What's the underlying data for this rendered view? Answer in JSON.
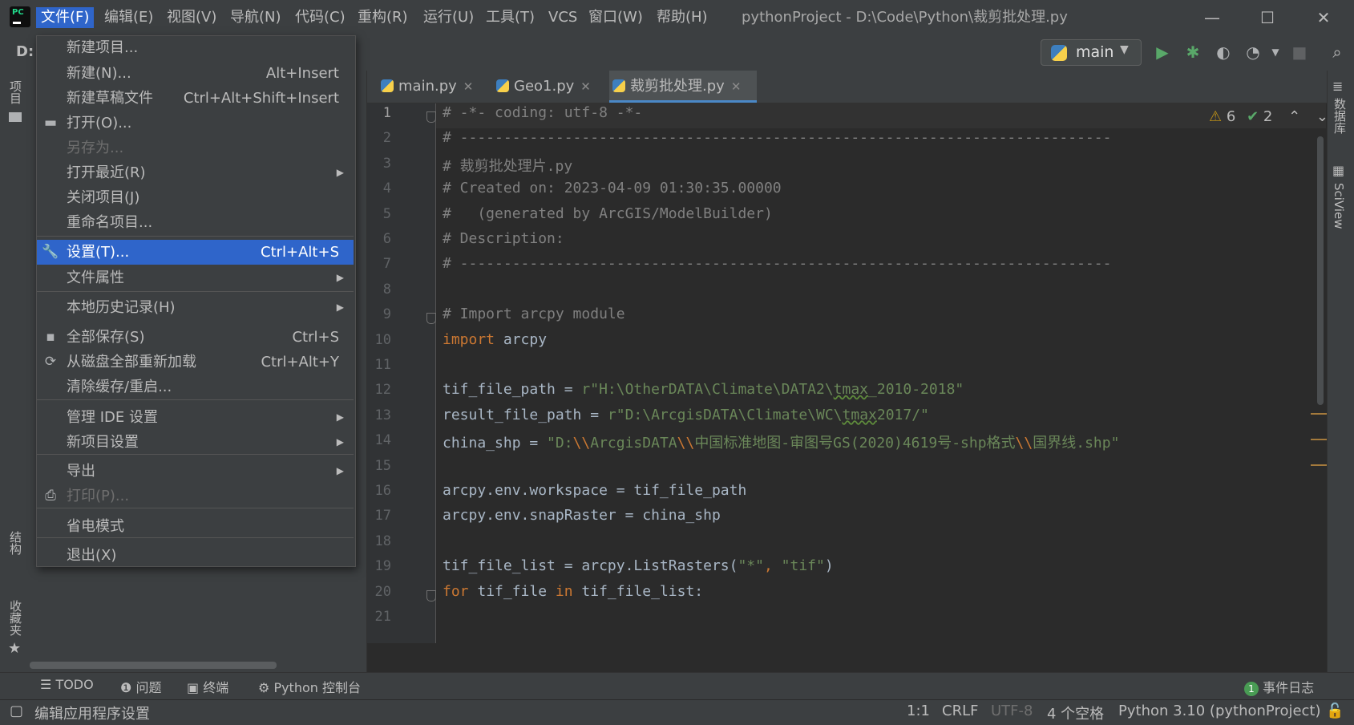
{
  "menubar": {
    "items": [
      "文件(F)",
      "编辑(E)",
      "视图(V)",
      "导航(N)",
      "代码(C)",
      "重构(R)",
      "运行(U)",
      "工具(T)",
      "VCS",
      "窗口(W)",
      "帮助(H)"
    ],
    "active_index": 0
  },
  "window": {
    "title": "pythonProject - D:\\Code\\Python\\裁剪批处理.py",
    "minimize": "—",
    "maximize": "☐",
    "close": "✕"
  },
  "toolbar": {
    "breadcrumb": "D:",
    "run_config": "main"
  },
  "file_menu": {
    "items": [
      {
        "label": "新建项目...",
        "shortcut": "",
        "submenu": false,
        "disabled": false,
        "icon": ""
      },
      {
        "label": "新建(N)...",
        "shortcut": "Alt+Insert",
        "submenu": false,
        "disabled": false,
        "icon": ""
      },
      {
        "label": "新建草稿文件",
        "shortcut": "Ctrl+Alt+Shift+Insert",
        "submenu": false,
        "disabled": false,
        "icon": ""
      },
      {
        "label": "打开(O)...",
        "shortcut": "",
        "submenu": false,
        "disabled": false,
        "icon": "folder-icon"
      },
      {
        "label": "另存为...",
        "shortcut": "",
        "submenu": false,
        "disabled": true,
        "icon": ""
      },
      {
        "label": "打开最近(R)",
        "shortcut": "",
        "submenu": true,
        "disabled": false,
        "icon": ""
      },
      {
        "label": "关闭项目(J)",
        "shortcut": "",
        "submenu": false,
        "disabled": false,
        "icon": ""
      },
      {
        "label": "重命名项目...",
        "shortcut": "",
        "submenu": false,
        "disabled": false,
        "icon": ""
      },
      {
        "label": "设置(T)...",
        "shortcut": "Ctrl+Alt+S",
        "submenu": false,
        "disabled": false,
        "icon": "wrench-icon",
        "selected": true
      },
      {
        "label": "文件属性",
        "shortcut": "",
        "submenu": true,
        "disabled": false,
        "icon": ""
      },
      {
        "label": "本地历史记录(H)",
        "shortcut": "",
        "submenu": true,
        "disabled": false,
        "icon": ""
      },
      {
        "label": "全部保存(S)",
        "shortcut": "Ctrl+S",
        "submenu": false,
        "disabled": false,
        "icon": "save-icon"
      },
      {
        "label": "从磁盘全部重新加载",
        "shortcut": "Ctrl+Alt+Y",
        "submenu": false,
        "disabled": false,
        "icon": "reload-icon"
      },
      {
        "label": "清除缓存/重启...",
        "shortcut": "",
        "submenu": false,
        "disabled": false,
        "icon": ""
      },
      {
        "label": "管理 IDE 设置",
        "shortcut": "",
        "submenu": true,
        "disabled": false,
        "icon": ""
      },
      {
        "label": "新项目设置",
        "shortcut": "",
        "submenu": true,
        "disabled": false,
        "icon": ""
      },
      {
        "label": "导出",
        "shortcut": "",
        "submenu": true,
        "disabled": false,
        "icon": ""
      },
      {
        "label": "打印(P)...",
        "shortcut": "",
        "submenu": false,
        "disabled": true,
        "icon": "print-icon"
      },
      {
        "label": "省电模式",
        "shortcut": "",
        "submenu": false,
        "disabled": false,
        "icon": ""
      },
      {
        "label": "退出(X)",
        "shortcut": "",
        "submenu": false,
        "disabled": false,
        "icon": ""
      }
    ]
  },
  "editor": {
    "tabs": [
      {
        "label": "main.py",
        "active": false
      },
      {
        "label": "Geo1.py",
        "active": false
      },
      {
        "label": "裁剪批处理.py",
        "active": true
      }
    ],
    "inspections": {
      "warnings": "6",
      "weak_warnings": "2"
    },
    "line_numbers": [
      "1",
      "2",
      "3",
      "4",
      "5",
      "6",
      "7",
      "8",
      "9",
      "10",
      "11",
      "12",
      "13",
      "14",
      "15",
      "16",
      "17",
      "18",
      "19",
      "20",
      "21"
    ],
    "lines": [
      "# -*- coding: utf-8 -*-",
      "# ---------------------------------------------------------------------------",
      "# 裁剪批处理片.py",
      "# Created on: 2023-04-09 01:30:35.00000",
      "#   (generated by ArcGIS/ModelBuilder)",
      "# Description:",
      "# ---------------------------------------------------------------------------",
      "",
      "# Import arcpy module",
      "import arcpy",
      "",
      "tif_file_path = r\"H:\\OtherDATA\\Climate\\DATA2\\tmax_2010-2018\"",
      "result_file_path = r\"D:\\ArcgisDATA\\Climate\\WC\\tmax2017/\"",
      "china_shp = \"D:\\\\ArcgisDATA\\\\中国标准地图-审图号GS(2020)4619号-shp格式\\\\国界线.shp\"",
      "",
      "arcpy.env.workspace = tif_file_path",
      "arcpy.env.snapRaster = china_shp",
      "",
      "tif_file_list = arcpy.ListRasters(\"*\", \"tif\")",
      "for tif_file in tif_file_list:",
      ""
    ]
  },
  "left_stripe": {
    "project": "项目",
    "structure": "结构",
    "bookmarks": "收藏夹"
  },
  "right_stripe": {
    "database": "数据库",
    "sciview": "SciView"
  },
  "tool_windows": [
    "TODO",
    "问题",
    "终端",
    "Python 控制台"
  ],
  "event_log": {
    "count": "1",
    "label": "事件日志"
  },
  "status_bar": {
    "message": "编辑应用程序设置",
    "position": "1:1",
    "line_sep": "CRLF",
    "encoding": "UTF-8",
    "indent": "4 个空格",
    "interpreter": "Python 3.10 (pythonProject)"
  },
  "colors": {
    "accent": "#2f65ca",
    "keyword": "#cc7832",
    "string": "#6a8759",
    "comment": "#808080"
  }
}
